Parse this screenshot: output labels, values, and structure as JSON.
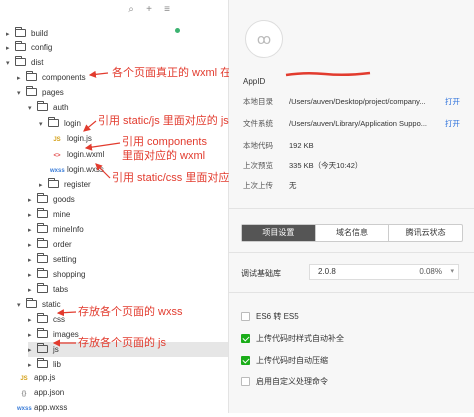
{
  "file_tree": {
    "items": [
      {
        "label": "build",
        "kind": "folder",
        "expanded": false
      },
      {
        "label": "config",
        "kind": "folder",
        "expanded": false
      },
      {
        "label": "dist",
        "kind": "folder",
        "expanded": true
      },
      {
        "label": "components",
        "kind": "folder",
        "expanded": false
      },
      {
        "label": "pages",
        "kind": "folder",
        "expanded": true
      },
      {
        "label": "auth",
        "kind": "folder",
        "expanded": true
      },
      {
        "label": "login",
        "kind": "folder",
        "expanded": true
      },
      {
        "label": "login.js",
        "kind": "file",
        "type": "JS"
      },
      {
        "label": "login.wxml",
        "kind": "file",
        "type": "<>"
      },
      {
        "label": "login.wxss",
        "kind": "file",
        "type": "wxss"
      },
      {
        "label": "register",
        "kind": "folder",
        "expanded": false
      },
      {
        "label": "goods",
        "kind": "folder",
        "expanded": false
      },
      {
        "label": "mine",
        "kind": "folder",
        "expanded": false
      },
      {
        "label": "mineInfo",
        "kind": "folder",
        "expanded": false
      },
      {
        "label": "order",
        "kind": "folder",
        "expanded": false
      },
      {
        "label": "setting",
        "kind": "folder",
        "expanded": false
      },
      {
        "label": "shopping",
        "kind": "folder",
        "expanded": false
      },
      {
        "label": "tabs",
        "kind": "folder",
        "expanded": false
      },
      {
        "label": "static",
        "kind": "folder",
        "expanded": true
      },
      {
        "label": "css",
        "kind": "folder",
        "expanded": false
      },
      {
        "label": "images",
        "kind": "folder",
        "expanded": false
      },
      {
        "label": "js",
        "kind": "folder",
        "expanded": false
      },
      {
        "label": "lib",
        "kind": "folder",
        "expanded": false
      },
      {
        "label": "app.js",
        "kind": "file",
        "type": "JS"
      },
      {
        "label": "app.json",
        "kind": "file",
        "type": "{}"
      },
      {
        "label": "app.wxss",
        "kind": "file",
        "type": "wxss"
      }
    ],
    "toolbar_icons": [
      "search-icon",
      "add-icon",
      "collapse-icon"
    ]
  },
  "annotations": {
    "components": "各个页面真正的 wxml 在这里",
    "login_js": "引用 static/js 里面对应的 js",
    "login_wxml_line1": "引用 components",
    "login_wxml_line2": "里面对应的 wxml",
    "login_wxss": "引用 static/css 里面对应的 wxss",
    "css": "存放各个页面的 wxss",
    "js": "存放各个页面的 js"
  },
  "details": {
    "appid_label": "AppID",
    "rows": [
      {
        "key": "本地目录",
        "value": "/Users/auven/Desktop/project/company...",
        "action": "打开"
      },
      {
        "key": "文件系统",
        "value": "/Users/auven/Library/Application Suppo...",
        "action": "打开"
      },
      {
        "key": "本地代码",
        "value": "192 KB"
      },
      {
        "key": "上次预览",
        "value": "335 KB（今天10:42）"
      },
      {
        "key": "上次上传",
        "value": "无"
      }
    ],
    "tabs": [
      {
        "label": "项目设置",
        "active": true
      },
      {
        "label": "域名信息",
        "active": false
      },
      {
        "label": "腾讯云状态",
        "active": false
      }
    ],
    "lib": {
      "label": "调试基础库",
      "version": "2.0.8",
      "percent": "0.08%"
    },
    "options": [
      {
        "label": "ES6 转 ES5",
        "checked": false
      },
      {
        "label": "上传代码时样式自动补全",
        "checked": true
      },
      {
        "label": "上传代码时自动压缩",
        "checked": true
      },
      {
        "label": "启用自定义处理命令",
        "checked": false
      }
    ]
  },
  "colors": {
    "annotation": "#e23b2e",
    "link": "#2a6fdb",
    "check": "#1aad19",
    "active_tab": "#555555"
  }
}
